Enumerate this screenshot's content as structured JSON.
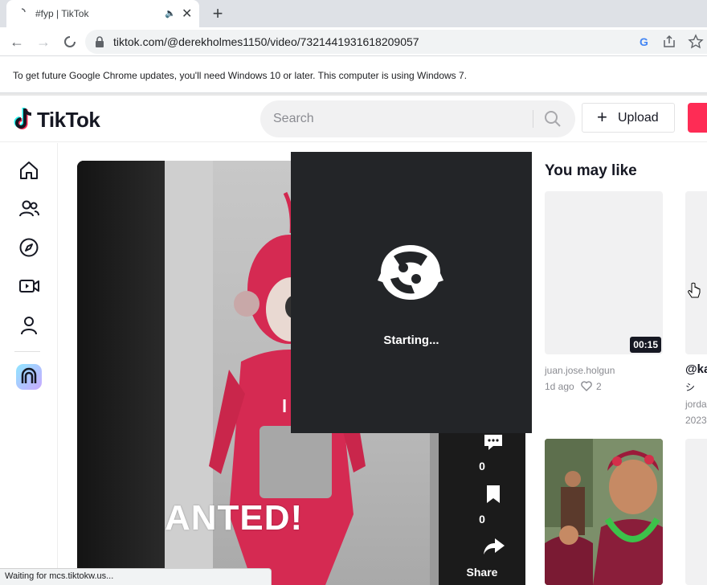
{
  "browser": {
    "tab_title": "#fyp | TikTok",
    "new_tab": "+",
    "url": "tiktok.com/@derekholmes1150/video/7321441931618209057",
    "infobar_text": "To get future Google Chrome updates, you'll need Windows 10 or later. This computer is using Windows 7.",
    "status_text": "Waiting for mcs.tiktokw.us..."
  },
  "header": {
    "logo_text": "TikTok",
    "search_placeholder": "Search",
    "upload_label": "Upload",
    "upload_plus": "+"
  },
  "sidebar": {
    "items": [
      "home-icon",
      "following-icon",
      "explore-icon",
      "live-icon",
      "profile-icon",
      "app-icon"
    ]
  },
  "video": {
    "caption_partial": "l",
    "overlay_text": "ANTED!",
    "actions": [
      {
        "icon": "comment-icon",
        "count": "0"
      },
      {
        "icon": "bookmark-icon",
        "count": "0"
      },
      {
        "icon": "share-icon",
        "label": "Share"
      }
    ]
  },
  "loader": {
    "text": "Starting..."
  },
  "recommendations": {
    "title": "You may like",
    "cards": [
      {
        "duration": "00:15",
        "author": "juan.jose.holgun",
        "age": "1d ago",
        "likes": "2"
      },
      {
        "handle": "@ka",
        "line2": "シ",
        "author": "jorda",
        "age": "2023"
      }
    ]
  },
  "colors": {
    "accent": "#fe2c55",
    "loader_bg": "#232528"
  }
}
